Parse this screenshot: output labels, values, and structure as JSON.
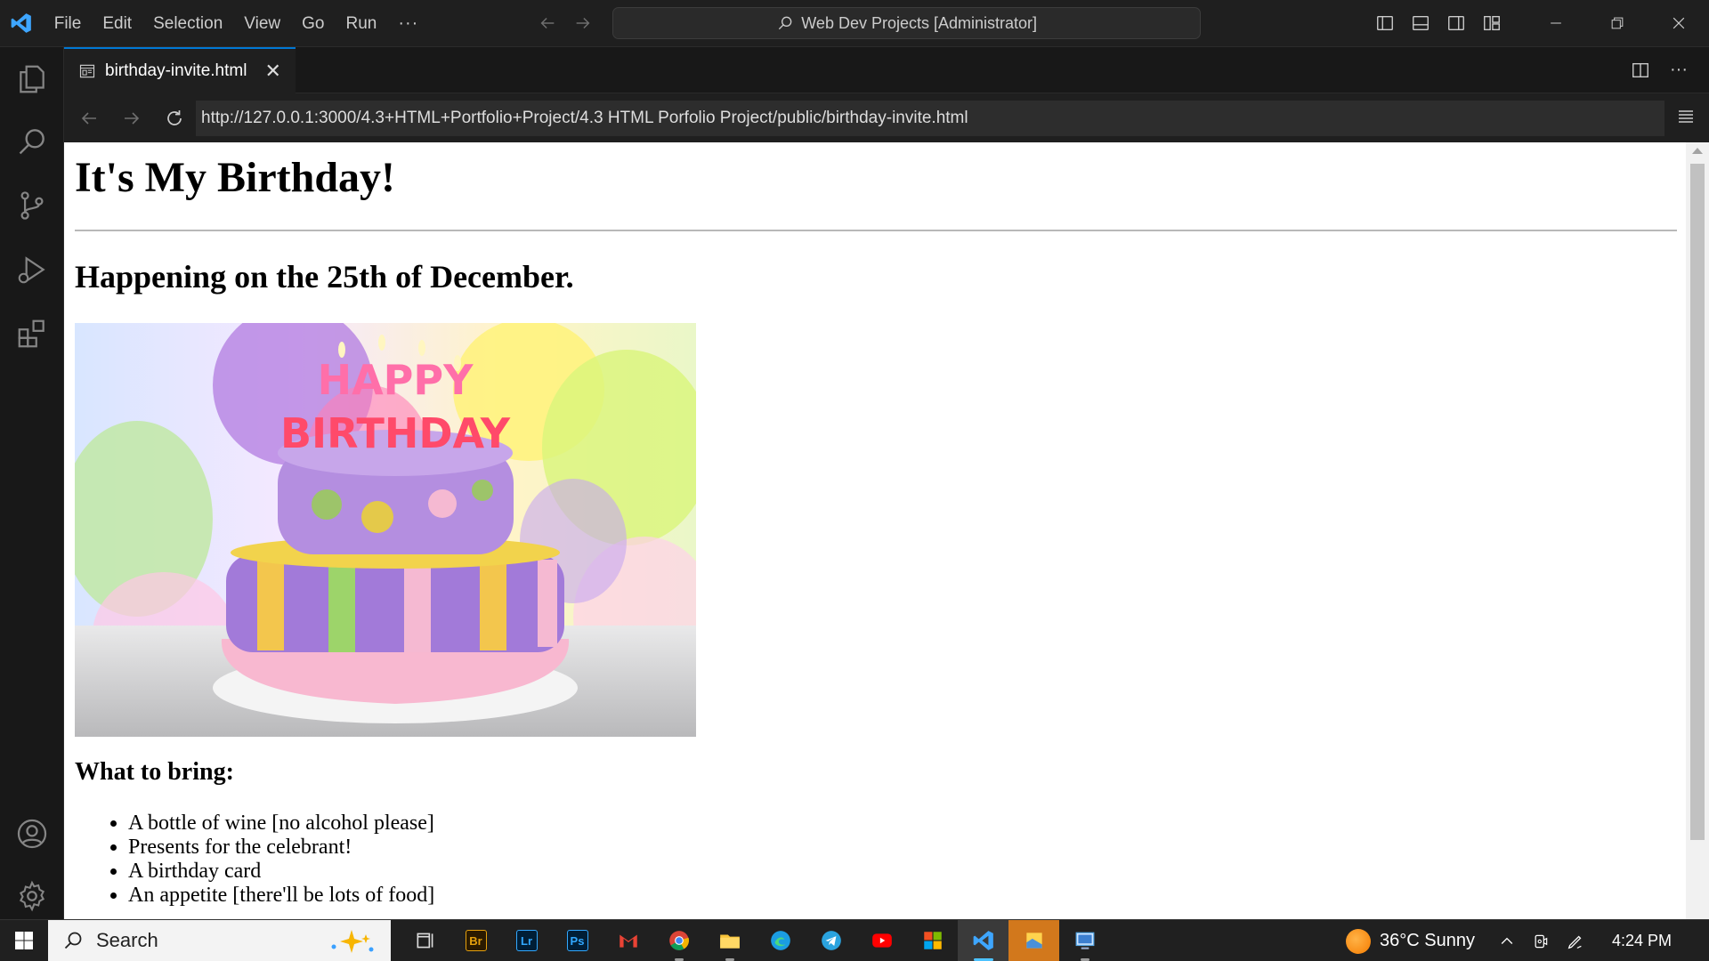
{
  "menu": [
    "File",
    "Edit",
    "Selection",
    "View",
    "Go",
    "Run"
  ],
  "menu_more": "···",
  "command_center": "Web Dev Projects [Administrator]",
  "tab": {
    "label": "birthday-invite.html"
  },
  "browser": {
    "url": "http://127.0.0.1:3000/4.3+HTML+Portfolio+Project/4.3 HTML Porfolio Project/public/birthday-invite.html"
  },
  "page": {
    "h1": "It's My Birthday!",
    "h2": "Happening on the 25th of December.",
    "h3": "What to bring:",
    "items": [
      "A bottle of wine [no alcohol please]",
      "Presents for the celebrant!",
      "A birthday card",
      "An appetite [there'll be lots of food]"
    ],
    "cake_text_top": "HAPPY",
    "cake_text_bottom": "BIRTHDAY"
  },
  "taskbar": {
    "search_label": "Search",
    "apps": [
      "task-view",
      "bridge",
      "lightroom",
      "photoshop",
      "gmail",
      "chrome",
      "file-explorer",
      "edge",
      "telegram",
      "youtube",
      "microsoft-store",
      "vscode",
      "sticky-app",
      "remote-desktop"
    ],
    "app_labels": {
      "bridge": "Br",
      "lightroom": "Lr",
      "photoshop": "Ps"
    },
    "weather": "36°C  Sunny",
    "time": "4:24 PM"
  },
  "colors": {
    "accent": "#0078d4",
    "vscode_blue": "#3ea6ff"
  }
}
